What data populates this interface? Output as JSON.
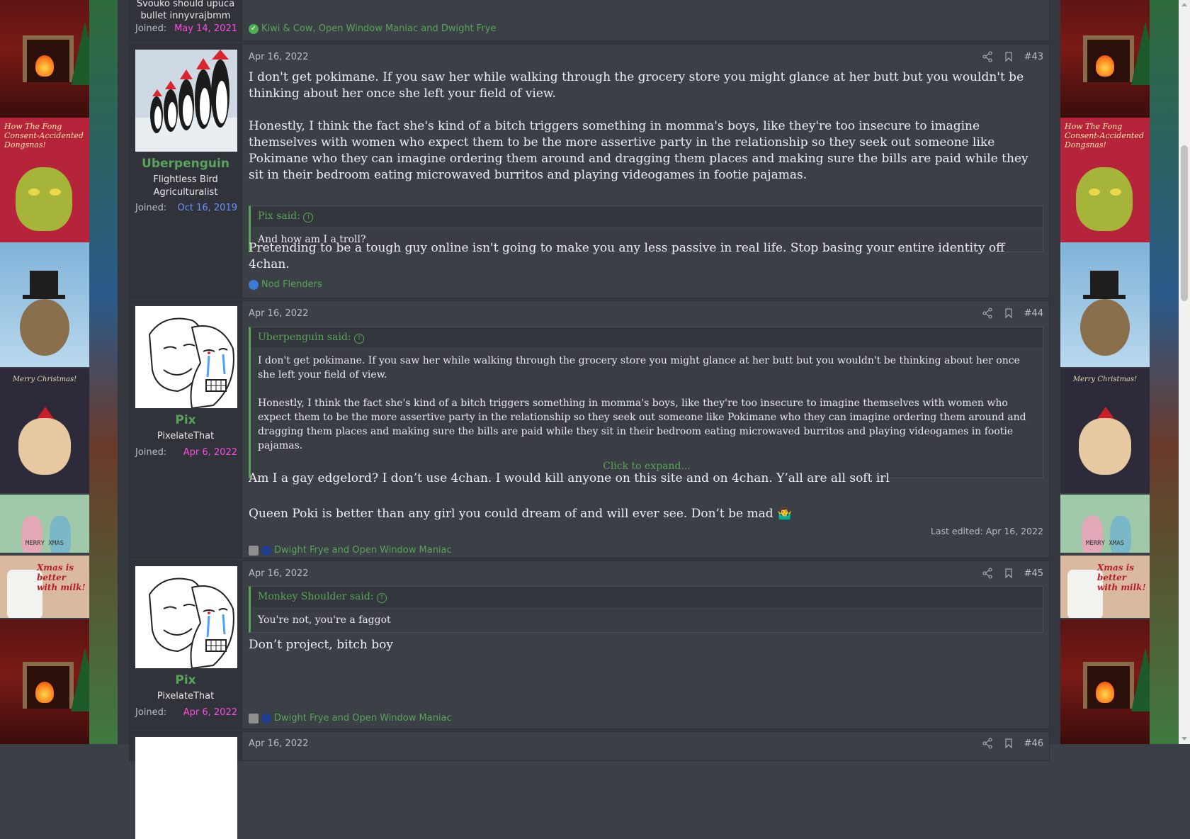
{
  "thread": {
    "prev_post": {
      "user_title_line1": "Svouko should upuca",
      "user_title_line2": "bullet innyvrajbmm",
      "joined_label": "Joined:",
      "joined_date": "May 14, 2021",
      "reactions": "Kiwi & Cow, Open Window Maniac and Dwight Frye"
    },
    "posts": [
      {
        "number": "#43",
        "date": "Apr 16, 2022",
        "username": "Uberpenguin",
        "user_title_1": "Flightless Bird",
        "user_title_2": "Agriculturalist",
        "joined_label": "Joined:",
        "joined_date": "Oct 16, 2019",
        "body_p1": "I don't get pokimane. If you saw her while walking through the grocery store you might glance at her butt but you wouldn't be thinking about her once she left your field of view.",
        "body_p2": "Honestly, I think the fact she's kind of a bitch triggers something in momma's boys, like they're too insecure to imagine themselves with women who expect them to be the more assertive party in the relationship so they seek out someone like Pokimane who they can imagine ordering them around and dragging them places and making sure the bills are paid while they sit in their bedroom eating microwaved burritos and playing videogames in footie pajamas.",
        "quote_author": "Pix said:",
        "quote_text": "And how am I a troll?",
        "body_p3": "Pretending to be a tough guy online isn't going to make you any less passive in real life. Stop basing your entire identity off 4chan.",
        "reactions": "Nod Flenders"
      },
      {
        "number": "#44",
        "date": "Apr 16, 2022",
        "username": "Pix",
        "user_title_1": "PixelateThat",
        "joined_label": "Joined:",
        "joined_date": "Apr 6, 2022",
        "quote_author": "Uberpenguin said:",
        "quote_p1": "I don't get pokimane. If you saw her while walking through the grocery store you might glance at her butt but you wouldn't be thinking about her once she left your field of view.",
        "quote_p2": "Honestly, I think the fact she's kind of a bitch triggers something in momma's boys, like they're too insecure to imagine themselves with women who expect them to be the more assertive party in the relationship so they seek out someone like Pokimane who they can imagine ordering them around and dragging them places and making sure the bills are paid while they sit in their bedroom eating microwaved burritos and playing videogames in footie pajamas.",
        "expand_label": "Click to expand...",
        "body_p1": "Am I a gay edgelord? I don’t use 4chan. I would kill anyone on this site and on 4chan. Y’all are all soft irl",
        "body_p2": "Queen Poki is better than any girl you could dream of and will ever see. Don’t be mad",
        "emoji": "🤷‍♂️",
        "last_edited": "Last edited: Apr 16, 2022",
        "reactions": "Dwight Frye and Open Window Maniac"
      },
      {
        "number": "#45",
        "date": "Apr 16, 2022",
        "username": "Pix",
        "user_title_1": "PixelateThat",
        "joined_label": "Joined:",
        "joined_date": "Apr 6, 2022",
        "quote_author": "Monkey Shoulder said:",
        "quote_text": "You're not, you're a faggot",
        "body_p1": "Don’t project, bitch boy",
        "reactions": "Dwight Frye and Open Window Maniac"
      },
      {
        "number": "#46",
        "date": "Apr 16, 2022"
      }
    ]
  },
  "background": {
    "grinch_text": "How The Fong Consent-Accidented Dongsnas!",
    "christmas_text": "Merry Christmas!",
    "xmas_text": "MERRY XMAS",
    "milk_text": "Xmas is better with milk!"
  },
  "colors": {
    "accent_green": "#5aa35a",
    "joined_pink": "#ff4ae0",
    "joined_blue": "#6f8fff",
    "post_bg": "#3b3f46"
  }
}
